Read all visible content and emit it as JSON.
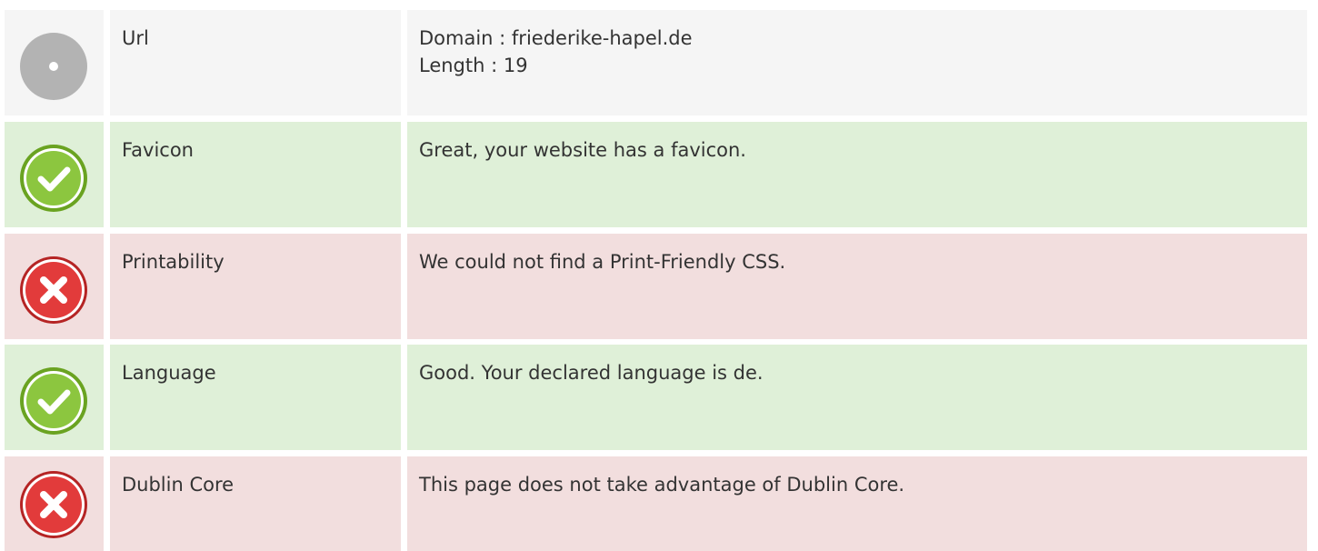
{
  "rows": [
    {
      "status": "neutral",
      "icon": "neutral-disc-icon",
      "name": "Url",
      "lines": [
        "Domain : friederike-hapel.de",
        "Length : 19"
      ]
    },
    {
      "status": "good",
      "icon": "check-circle-icon",
      "name": "Favicon",
      "lines": [
        "Great, your website has a favicon."
      ]
    },
    {
      "status": "bad",
      "icon": "error-cross-icon",
      "name": "Printability",
      "lines": [
        "We could not find a Print-Friendly CSS."
      ]
    },
    {
      "status": "good",
      "icon": "check-circle-icon",
      "name": "Language",
      "lines": [
        "Good. Your declared language is de."
      ]
    },
    {
      "status": "bad",
      "icon": "error-cross-icon",
      "name": "Dublin Core",
      "lines": [
        "This page does not take advantage of Dublin Core."
      ]
    }
  ],
  "colors": {
    "neutral_bg": "#f5f5f5",
    "good_bg": "#dff0d8",
    "bad_bg": "#f2dede",
    "good_icon": "#8cc63f",
    "bad_icon": "#e23b3b",
    "neutral_icon": "#b3b3b3"
  }
}
